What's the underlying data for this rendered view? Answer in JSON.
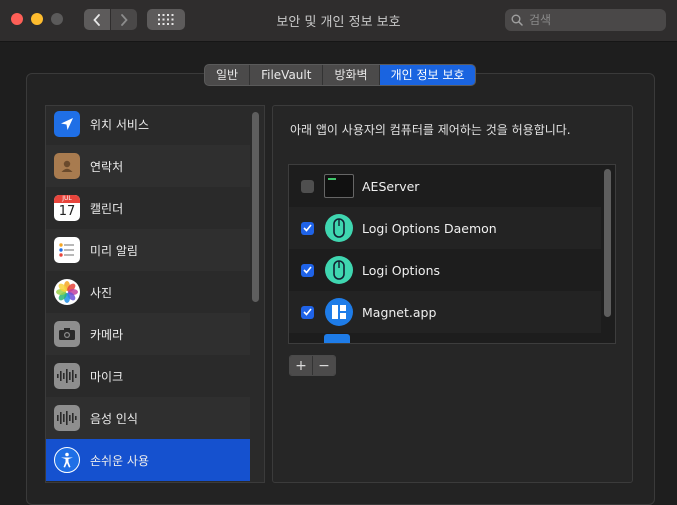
{
  "window": {
    "title": "보안 및 개인 정보 보호"
  },
  "search": {
    "placeholder": "검색"
  },
  "tabs": [
    {
      "label": "일반",
      "active": false
    },
    {
      "label": "FileVault",
      "active": false
    },
    {
      "label": "방화벽",
      "active": false
    },
    {
      "label": "개인 정보 보호",
      "active": true
    }
  ],
  "sidebar": {
    "items": [
      {
        "label": "위치 서비스",
        "icon": "location-arrow-icon"
      },
      {
        "label": "연락처",
        "icon": "contacts-book-icon"
      },
      {
        "label": "캘린더",
        "icon": "calendar-icon",
        "icon_month": "JUL",
        "icon_day": "17"
      },
      {
        "label": "미리 알림",
        "icon": "reminders-list-icon"
      },
      {
        "label": "사진",
        "icon": "photos-flower-icon"
      },
      {
        "label": "카메라",
        "icon": "camera-icon"
      },
      {
        "label": "마이크",
        "icon": "microphone-waveform-icon"
      },
      {
        "label": "음성 인식",
        "icon": "speech-waveform-icon"
      },
      {
        "label": "손쉬운 사용",
        "icon": "accessibility-icon",
        "selected": true
      }
    ]
  },
  "main": {
    "description": "아래 앱이 사용자의 컴퓨터를 제어하는 것을 허용합니다.",
    "apps": [
      {
        "name": "AEServer",
        "checked": false,
        "icon": "terminal-app-icon"
      },
      {
        "name": "Logi Options Daemon",
        "checked": true,
        "icon": "logi-mouse-icon"
      },
      {
        "name": "Logi Options",
        "checked": true,
        "icon": "logi-mouse-icon"
      },
      {
        "name": "Magnet.app",
        "checked": true,
        "icon": "magnet-app-icon"
      }
    ],
    "add_label": "+",
    "remove_label": "−"
  },
  "colors": {
    "accent": "#1551cf",
    "checkbox": "#1f63e8",
    "close": "#fe5f57",
    "minimize": "#febc2e"
  }
}
